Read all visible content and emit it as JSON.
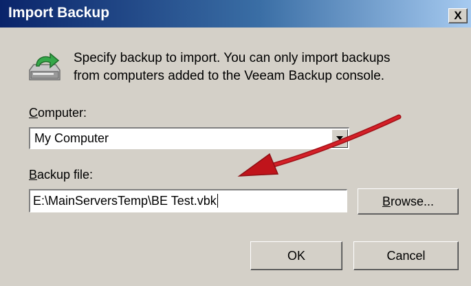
{
  "window": {
    "title": "Import Backup",
    "close_label": "X"
  },
  "dialog": {
    "instructions_line1": "Specify backup to import. You can only import backups",
    "instructions_line2": "from computers added to the Veeam Backup console.",
    "computer_label_accel": "C",
    "computer_label_rest": "omputer:",
    "computer_value": "My Computer",
    "backup_label_accel": "B",
    "backup_label_rest": "ackup file:",
    "backup_value": "E:\\MainServersTemp\\BE Test.vbk",
    "browse_accel": "B",
    "browse_rest": "rowse...",
    "ok_label": "OK",
    "cancel_label": "Cancel"
  },
  "icons": {
    "header": "import-backup-icon",
    "dropdown": "dropdown-arrow-icon",
    "annotation": "red-arrow-annotation"
  },
  "colors": {
    "title_bar": "#0a246a",
    "dialog_bg": "#d4d0c8",
    "annotation_arrow": "#c0141b"
  }
}
